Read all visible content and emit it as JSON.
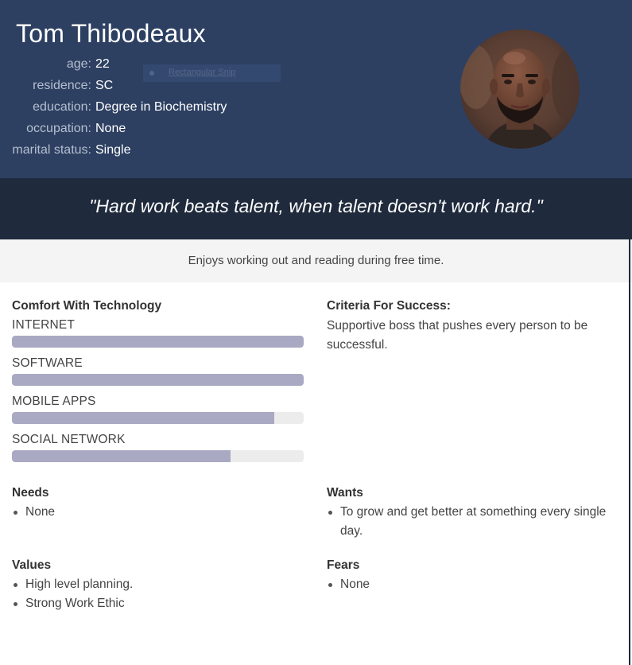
{
  "profile": {
    "name": "Tom Thibodeaux",
    "facts": [
      {
        "label": "age:",
        "value": "22"
      },
      {
        "label": "residence:",
        "value": "SC"
      },
      {
        "label": "education:",
        "value": "Degree in Biochemistry"
      },
      {
        "label": "occupation:",
        "value": "None"
      },
      {
        "label": "marital status:",
        "value": "Single"
      }
    ],
    "overlay_text": "Rectangular Snip"
  },
  "quote": "\"Hard work beats talent, when talent doesn't work hard.\"",
  "bio": "Enjoys working out and reading during free time.",
  "technology": {
    "heading": "Comfort With Technology",
    "items": [
      {
        "label": "INTERNET",
        "level": 1.0
      },
      {
        "label": "SOFTWARE",
        "level": 1.0
      },
      {
        "label": "MOBILE APPS",
        "level": 0.9
      },
      {
        "label": "SOCIAL NETWORK",
        "level": 0.75
      }
    ]
  },
  "criteria": {
    "heading": "Criteria For Success:",
    "text": "Supportive boss that pushes every person to be successful."
  },
  "needs": {
    "heading": "Needs",
    "items": [
      "None"
    ]
  },
  "wants": {
    "heading": "Wants",
    "items": [
      "To grow and get better at something every single day."
    ]
  },
  "values": {
    "heading": "Values",
    "items": [
      "High level planning.",
      "Strong Work Ethic"
    ]
  },
  "fears": {
    "heading": "Fears",
    "items": [
      "None"
    ]
  },
  "colors": {
    "header": "#2d4062",
    "quote_band": "#1f2a3c",
    "bar_fill": "#a9a9c3",
    "bar_track": "#ececec"
  }
}
